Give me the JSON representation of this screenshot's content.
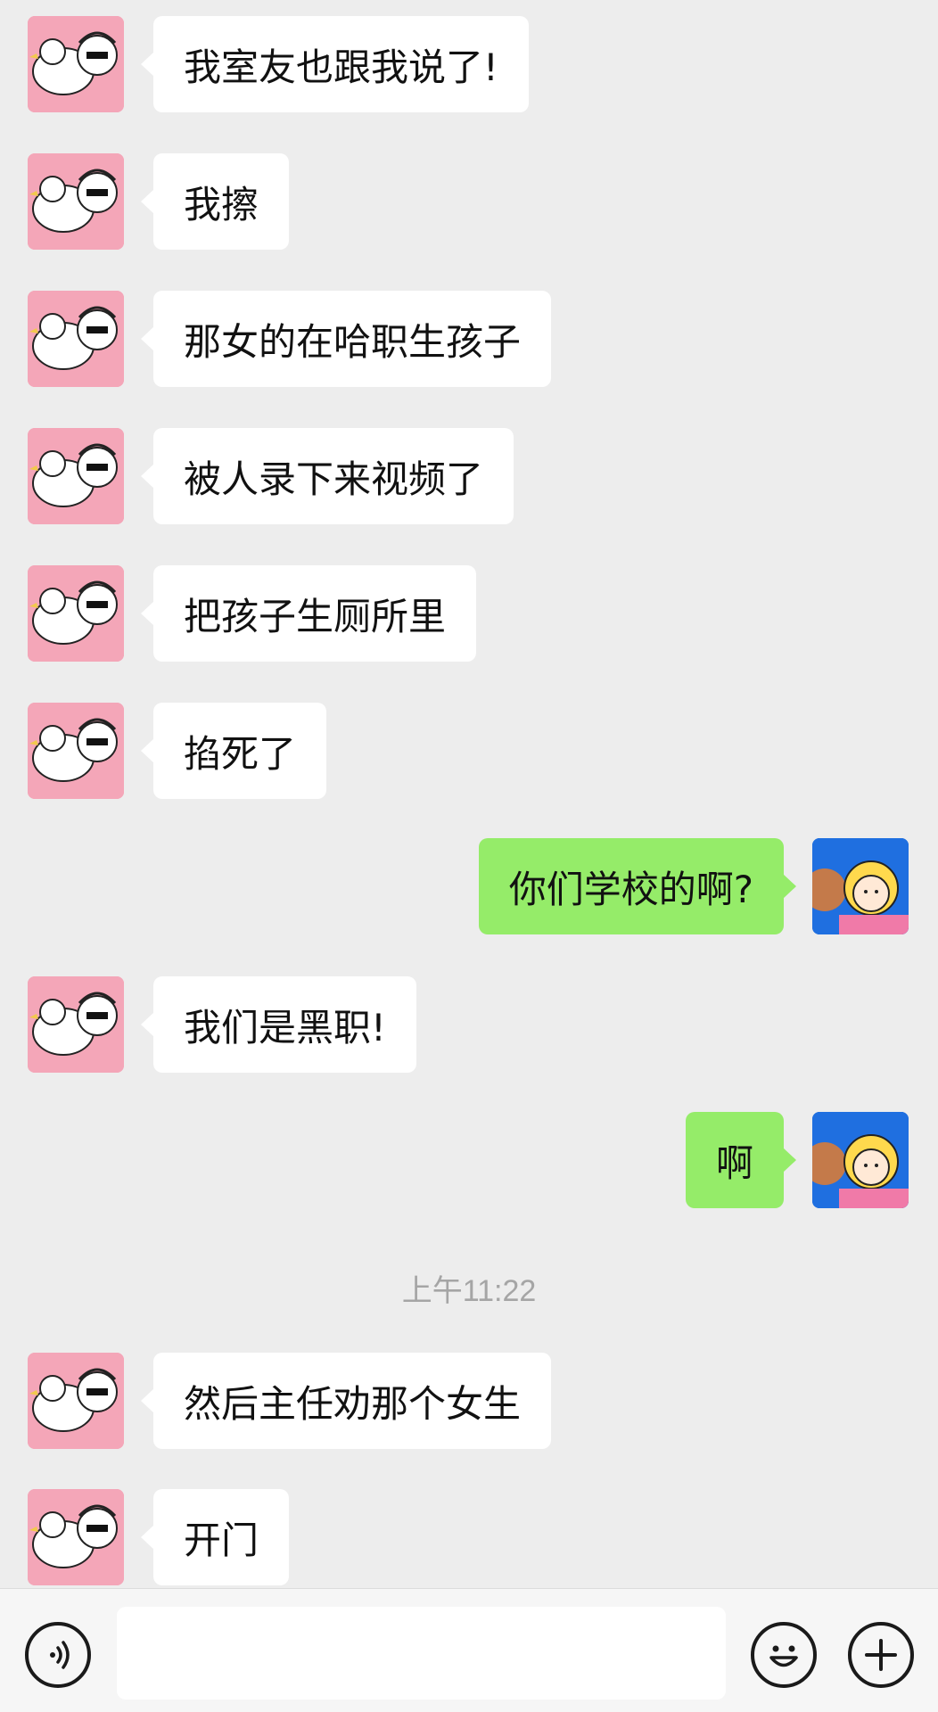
{
  "messages": [
    {
      "side": "left",
      "text": "我室友也跟我说了!"
    },
    {
      "side": "left",
      "text": "我擦"
    },
    {
      "side": "left",
      "text": "那女的在哈职生孩子"
    },
    {
      "side": "left",
      "text": "被人录下来视频了"
    },
    {
      "side": "left",
      "text": "把孩子生厕所里"
    },
    {
      "side": "left",
      "text": "掐死了"
    },
    {
      "side": "right",
      "text": "你们学校的啊?"
    },
    {
      "side": "left",
      "text": "我们是黑职!"
    },
    {
      "side": "right",
      "text": "啊"
    },
    {
      "side": "left",
      "text": "然后主任劝那个女生"
    },
    {
      "side": "left",
      "text": "开门"
    }
  ],
  "timestamp": "上午11:22",
  "input_bar": {
    "voice_icon": "voice-icon",
    "emoji_icon": "emoji-icon",
    "plus_icon": "plus-icon",
    "text_value": ""
  },
  "colors": {
    "background": "#ededed",
    "incoming_bubble": "#ffffff",
    "outgoing_bubble": "#95ec69",
    "timestamp_text": "#a5a5a5"
  }
}
